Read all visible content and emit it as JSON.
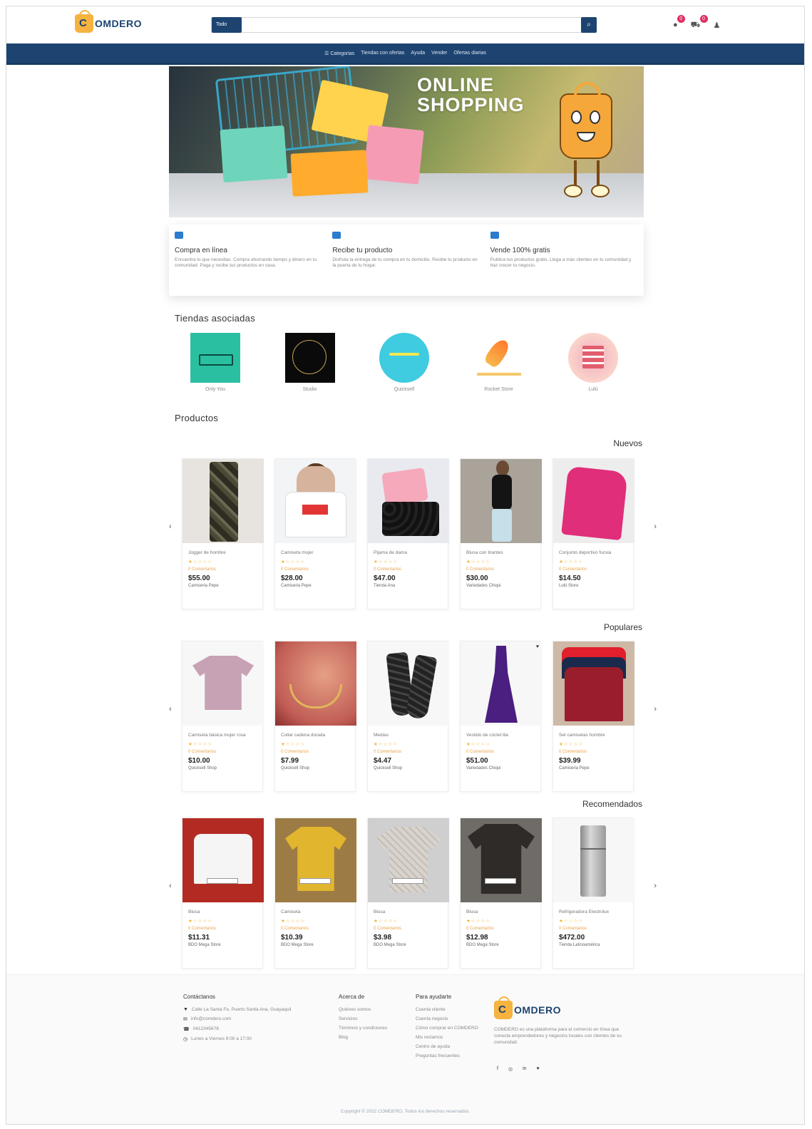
{
  "header": {
    "logo_text": "OMDERO",
    "search_category": "Todo",
    "search_placeholder": "",
    "icons": [
      "bell-icon",
      "cart-icon",
      "user-icon"
    ],
    "badges": {
      "notifications": "0",
      "cart": "0"
    }
  },
  "nav": {
    "links": [
      "☰ Categorias",
      "Tiendas con ofertas",
      "Ayuda",
      "Vender",
      "Ofertas diarias"
    ]
  },
  "banner": {
    "title_line1": "ONLINE",
    "title_line2": "SHOPPING"
  },
  "features": [
    {
      "title": "Compra en línea",
      "text": "Encuentra lo que necesitas. Compra ahorrando tiempo y dinero en tu comunidad. Paga y recibe tus productos en casa."
    },
    {
      "title": "Recibe tu producto",
      "text": "Disfruta la entrega de tu compra en tu domicilio. Recibe tu producto en la puerta de tu hogar."
    },
    {
      "title": "Vende 100% gratis",
      "text": "Publica tus productos gratis. Llega a más clientes en tu comunidad y haz crecer tu negocio."
    }
  ],
  "stores_section": {
    "title": "Tiendas asociadas",
    "stores": [
      "Only You",
      "Studio",
      "Quicksell",
      "Rocket Store",
      "Lulú"
    ]
  },
  "products_section": {
    "title": "Productos",
    "groups": [
      {
        "label": "Nuevos",
        "products": [
          {
            "name": "Jogger de hombre",
            "stars": "★☆☆☆☆",
            "comments": "0 Comentarios",
            "price": "$55.00",
            "store": "Camiseria Pepe"
          },
          {
            "name": "Camiseta mujer",
            "stars": "★☆☆☆☆",
            "comments": "0 Comentarios",
            "price": "$28.00",
            "store": "Camiseria Pepe"
          },
          {
            "name": "Pijama de dama",
            "stars": "★☆☆☆☆",
            "comments": "0 Comentarios",
            "price": "$47.00",
            "store": "Tienda Ana"
          },
          {
            "name": "Blusa con tirantes",
            "stars": "★☆☆☆☆",
            "comments": "0 Comentarios",
            "price": "$30.00",
            "store": "Variedades Chiqui"
          },
          {
            "name": "Conjunto deportivo fucsia",
            "stars": "★☆☆☆☆",
            "comments": "0 Comentarios",
            "price": "$14.50",
            "store": "Lulú Store"
          }
        ]
      },
      {
        "label": "Populares",
        "products": [
          {
            "name": "Camiseta básica mujer rosa",
            "stars": "★☆☆☆☆",
            "comments": "0 Comentarios",
            "price": "$10.00",
            "store": "Quicksell Shop"
          },
          {
            "name": "Collar cadena dorada",
            "stars": "★☆☆☆☆",
            "comments": "0 Comentarios",
            "price": "$7.99",
            "store": "Quicksell Shop"
          },
          {
            "name": "Medias",
            "stars": "★☆☆☆☆",
            "comments": "0 Comentarios",
            "price": "$4.47",
            "store": "Quicksell Shop"
          },
          {
            "name": "Vestido de cóctel lila",
            "stars": "★☆☆☆☆",
            "comments": "0 Comentarios",
            "price": "$51.00",
            "store": "Variedades Chiqui"
          },
          {
            "name": "Set camisetas hombre",
            "stars": "★☆☆☆☆",
            "comments": "0 Comentarios",
            "price": "$39.99",
            "store": "Camiseria Pepe"
          }
        ]
      },
      {
        "label": "Recomendados",
        "products": [
          {
            "name": "Blusa",
            "stars": "★☆☆☆☆",
            "comments": "0 Comentarios",
            "price": "$11.31",
            "store": "BDO Mega Store"
          },
          {
            "name": "Camiseta",
            "stars": "★☆☆☆☆",
            "comments": "0 Comentarios",
            "price": "$10.39",
            "store": "BDO Mega Store"
          },
          {
            "name": "Blusa",
            "stars": "★☆☆☆☆",
            "comments": "0 Comentarios",
            "price": "$3.98",
            "store": "BDO Mega Store"
          },
          {
            "name": "Blusa",
            "stars": "★☆☆☆☆",
            "comments": "0 Comentarios",
            "price": "$12.98",
            "store": "BDO Mega Store"
          },
          {
            "name": "Refrigeradora Electrolux",
            "stars": "★☆☆☆☆",
            "comments": "0 Comentarios",
            "price": "$472.00",
            "store": "Tienda Latinoamérica"
          }
        ]
      }
    ]
  },
  "footer": {
    "contact": {
      "title": "Contáctanos",
      "items": [
        {
          "icon": "location-icon",
          "text": "Calle La Santa Fe, Puerto Santa Ana, Guayaquil"
        },
        {
          "icon": "email-icon",
          "text": "info@comdero.com"
        },
        {
          "icon": "phone-icon",
          "text": "0412345678"
        },
        {
          "icon": "clock-icon",
          "text": "Lunes a Viernes 9:00 a 17:00"
        }
      ]
    },
    "about": {
      "title": "Acerca de",
      "items": [
        "Quiénes somos",
        "Servicios",
        "Términos y condiciones",
        "Blog"
      ]
    },
    "help": {
      "title": "Para ayudarte",
      "items": [
        "Cuenta cliente",
        "Cuenta negocio",
        "Cómo comprar en COMDERO",
        "Mis reclamos",
        "Centro de ayuda",
        "Preguntas frecuentes"
      ]
    },
    "logo_text": "OMDERO",
    "description": "COMDERO es una plataforma para el comercio en línea que conecta emprendedores y negocios locales con clientes de su comunidad.",
    "socials": [
      "f",
      "◎",
      "in",
      "♥"
    ],
    "copyright": "Copyright © 2022 COMDERO. Todos los derechos reservados."
  }
}
